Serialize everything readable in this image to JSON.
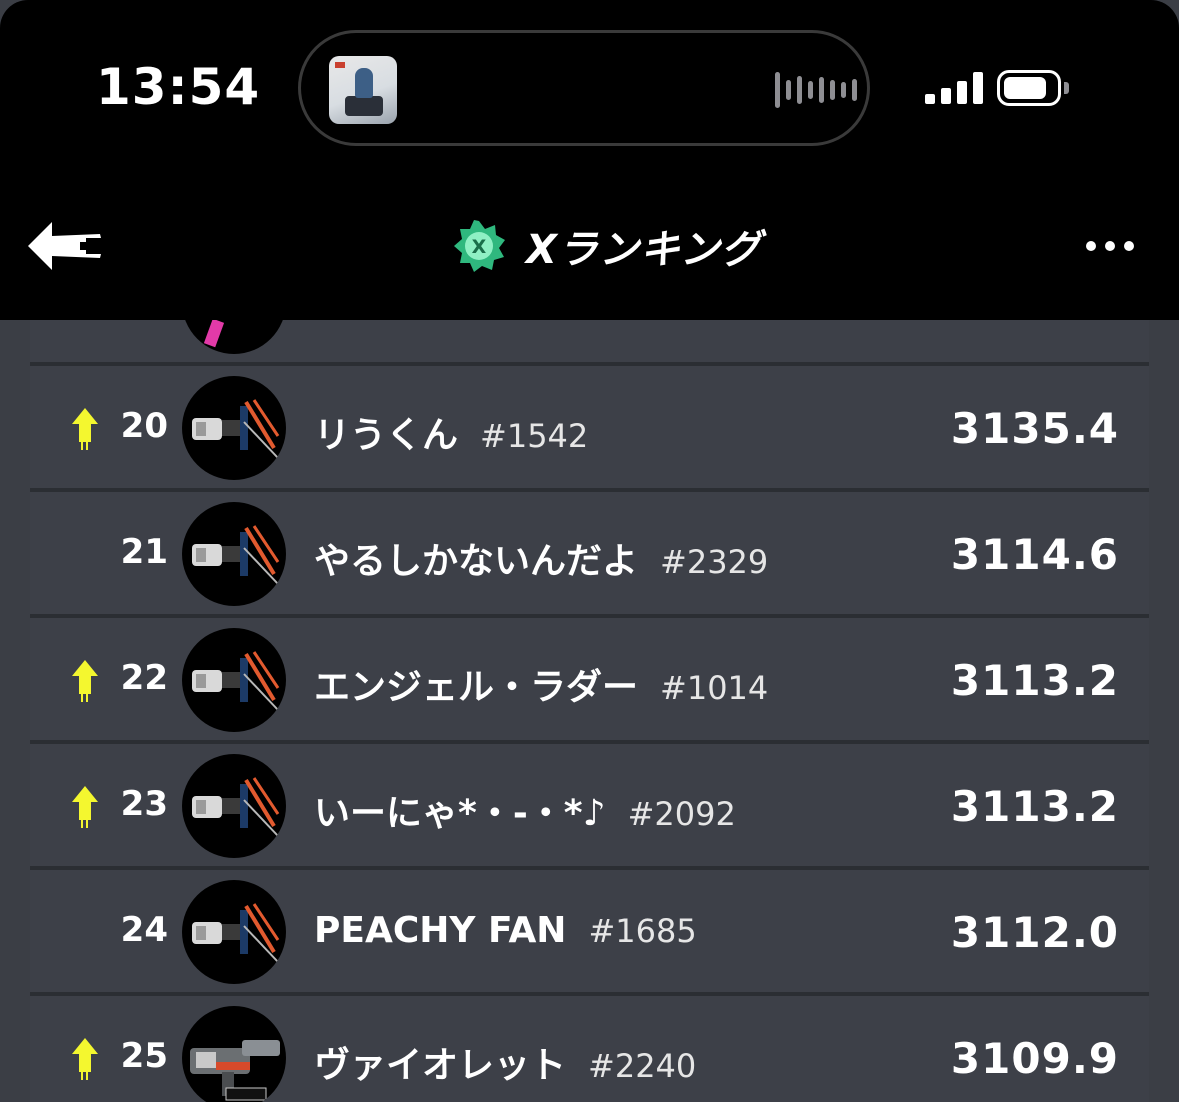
{
  "status_bar": {
    "time": "13:54",
    "battery_level": 0.8
  },
  "header": {
    "title": "Xランキング",
    "back_icon": "back-arrow-icon",
    "badge_icon": "x-rank-badge-icon",
    "more_icon": "more-dots-icon"
  },
  "colors": {
    "background": "#3b3e45",
    "row": "#3d4048",
    "header": "#000000",
    "up_arrow": "#f4f72f"
  },
  "rankings": [
    {
      "rank": "20",
      "trend": "up",
      "name": "リうくん",
      "tag": "#1542",
      "power": "3135.4",
      "weapon": "splatana-icon"
    },
    {
      "rank": "21",
      "trend": "none",
      "name": "やるしかないんだよ",
      "tag": "#2329",
      "power": "3114.6",
      "weapon": "splatana-icon"
    },
    {
      "rank": "22",
      "trend": "up",
      "name": "エンジェル・ラダー",
      "tag": "#1014",
      "power": "3113.2",
      "weapon": "splatana-icon"
    },
    {
      "rank": "23",
      "trend": "up",
      "name": "いーにゃ*・-・*♪",
      "tag": "#2092",
      "power": "3113.2",
      "weapon": "splatana-icon"
    },
    {
      "rank": "24",
      "trend": "none",
      "name": "PEACHY FAN",
      "tag": "#1685",
      "power": "3112.0",
      "weapon": "splatana-icon"
    },
    {
      "rank": "25",
      "trend": "up",
      "name": "ヴァイオレット",
      "tag": "#2240",
      "power": "3109.9",
      "weapon": "blaster-icon"
    }
  ]
}
